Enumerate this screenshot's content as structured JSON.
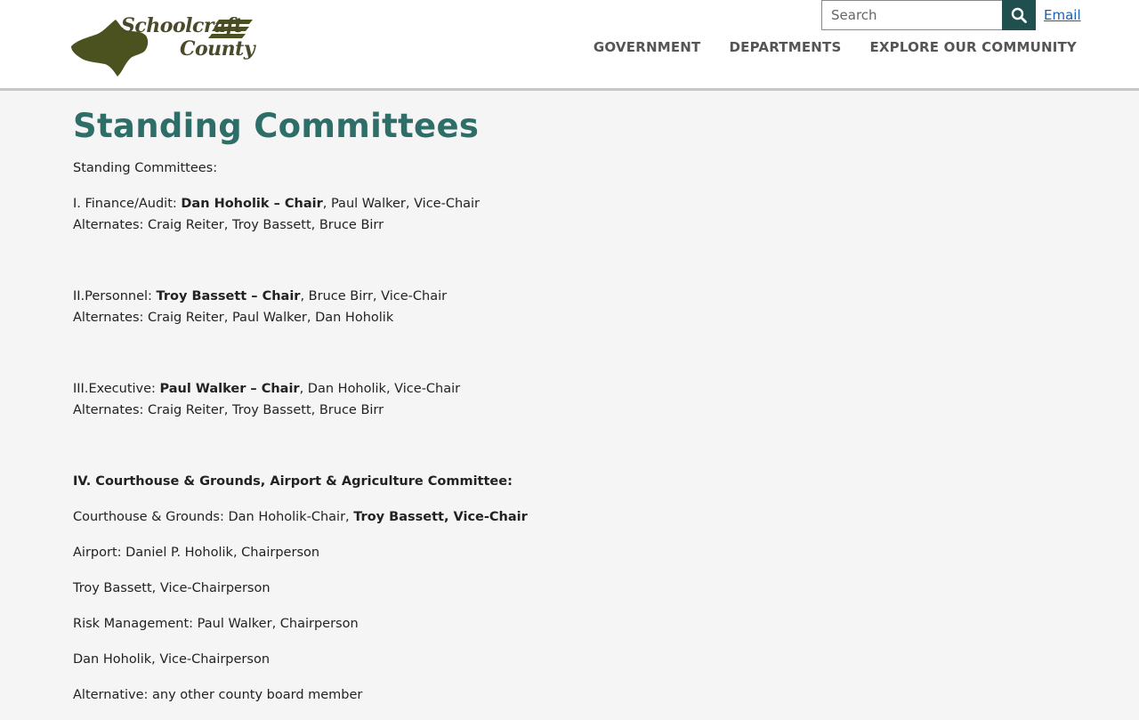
{
  "brand": {
    "line1": "Schoolcraft",
    "line2": "County",
    "color": "#4a4a2a"
  },
  "search": {
    "placeholder": "Search",
    "value": ""
  },
  "header": {
    "email_label": "Email"
  },
  "nav": [
    {
      "label": "GOVERNMENT"
    },
    {
      "label": "DEPARTMENTS"
    },
    {
      "label": "EXPLORE OUR COMMUNITY"
    }
  ],
  "page": {
    "title": "Standing Committees",
    "intro": "Standing Committees:",
    "committees": [
      {
        "prefix": "I. Finance/Audit: ",
        "chair": "Dan Hoholik – Chair",
        "rest": ", Paul Walker, Vice-Chair",
        "alternates": "Alternates: Craig Reiter, Troy Bassett, Bruce Birr"
      },
      {
        "prefix": "II.Personnel: ",
        "chair": "Troy Bassett – Chair",
        "rest": ", Bruce Birr, Vice-Chair",
        "alternates": "Alternates: Craig Reiter, Paul Walker, Dan Hoholik"
      },
      {
        "prefix": "III.Executive: ",
        "chair": "Paul Walker – Chair",
        "rest": ", Dan Hoholik, Vice-Chair",
        "alternates": "Alternates: Craig Reiter, Troy Bassett, Bruce Birr"
      }
    ],
    "committee4": {
      "heading": "IV. Courthouse & Grounds, Airport & Agriculture Committee:",
      "courthouse_prefix": "Courthouse & Grounds:  Dan Hoholik-Chair, ",
      "courthouse_bold": "Troy Bassett, Vice-Chair",
      "lines": [
        "Airport: Daniel P. Hoholik, Chairperson",
        "Troy Bassett, Vice-Chairperson",
        "Risk Management: Paul Walker, Chairperson",
        "Dan Hoholik, Vice-Chairperson",
        "Alternative: any other county board member"
      ]
    }
  },
  "colors": {
    "title": "#2e6e68",
    "search_button": "#1f4f4f",
    "link": "#1a5fb4"
  }
}
